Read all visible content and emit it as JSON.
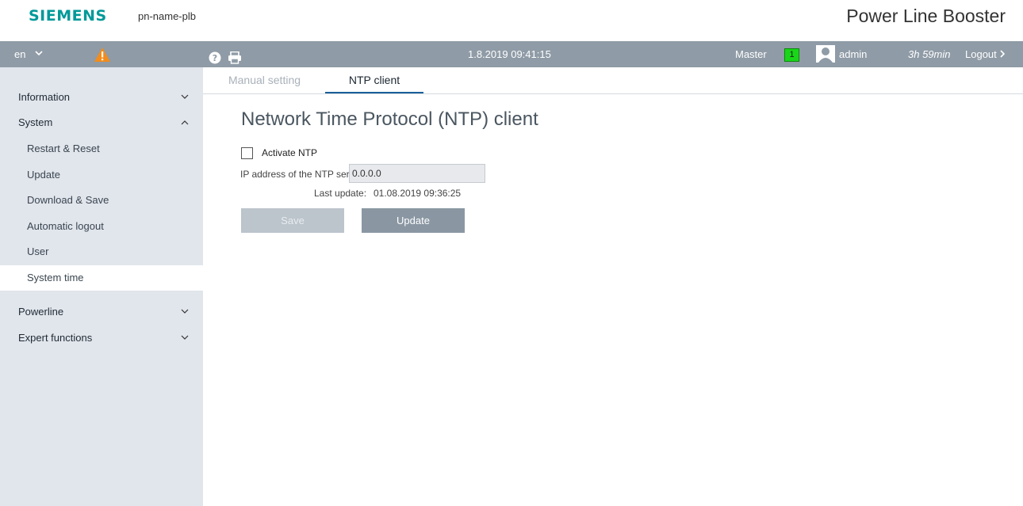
{
  "header": {
    "brand": "SIEMENS",
    "device_name": "pn-name-plb",
    "product_title": "Power Line Booster"
  },
  "topbar": {
    "language": "en",
    "datetime": "1.8.2019 09:41:15",
    "role": "Master",
    "master_count": "1",
    "username": "admin",
    "session_remaining": "3h 59min",
    "logout_label": "Logout"
  },
  "sidebar": {
    "items": [
      {
        "label": "Information",
        "state": "collapsed"
      },
      {
        "label": "System",
        "state": "expanded"
      },
      {
        "label": "Powerline",
        "state": "collapsed"
      },
      {
        "label": "Expert functions",
        "state": "collapsed"
      }
    ],
    "system_subitems": [
      {
        "label": "Restart & Reset"
      },
      {
        "label": "Update"
      },
      {
        "label": "Download & Save"
      },
      {
        "label": "Automatic logout"
      },
      {
        "label": "User"
      },
      {
        "label": "System time",
        "active": true
      }
    ]
  },
  "tabs": [
    {
      "label": "Manual setting",
      "active": false
    },
    {
      "label": "NTP client",
      "active": true
    }
  ],
  "content": {
    "heading": "Network Time Protocol (NTP) client",
    "activate_ntp_label": "Activate NTP",
    "activate_ntp_checked": false,
    "ip_label": "IP address of the NTP server:",
    "ip_value": "0.0.0.0",
    "last_update_label": "Last update:",
    "last_update_value": "01.08.2019 09:36:25",
    "save_label": "Save",
    "update_label": "Update"
  },
  "colors": {
    "brand": "#009999",
    "topbar": "#8f9ba6",
    "sidebar": "#e1e5ec",
    "master_status": "#19d619",
    "warning": "#f28c1c",
    "tab_active_underline": "#1a5f9a"
  },
  "icons": [
    "chevron-down-icon",
    "warning-icon",
    "help-icon",
    "print-icon",
    "user-avatar-icon",
    "chevron-right-icon",
    "chevron-up-icon"
  ]
}
